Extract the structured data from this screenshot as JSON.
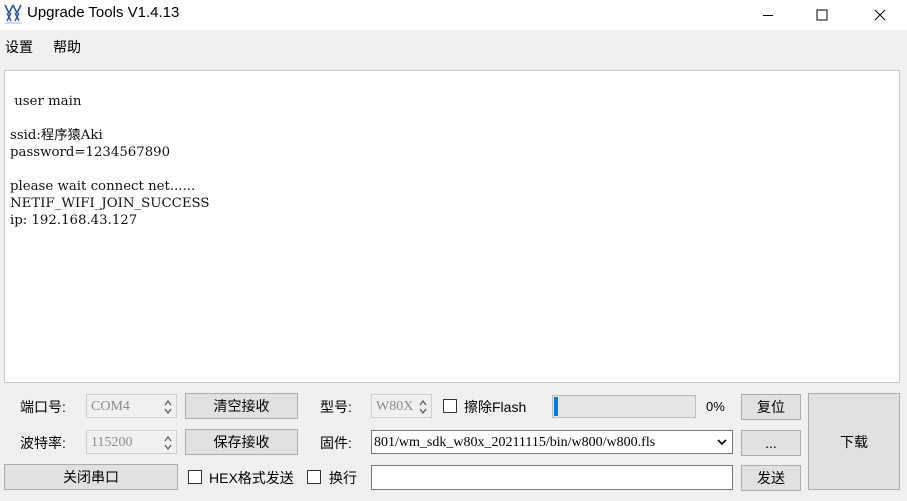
{
  "window": {
    "title": "Upgrade Tools V1.4.13",
    "logo_icon": "wm-logo-icon",
    "controls": [
      "minimize-icon",
      "maximize-icon",
      "close-icon"
    ]
  },
  "menu": {
    "items": [
      "设置",
      "帮助"
    ]
  },
  "console": {
    "lines": [
      " user main",
      "",
      "ssid:程序猿Aki",
      "password=1234567890",
      "",
      "please wait connect net......",
      "NETIF_WIFI_JOIN_SUCCESS",
      "ip: 192.168.43.127"
    ]
  },
  "serial": {
    "port_label": "端口号:",
    "port_value": "COM4",
    "baud_label": "波特率:",
    "baud_value": "115200",
    "clear_label": "清空接收",
    "save_label": "保存接收",
    "close_port_label": "关闭串口",
    "hex_send_label": "HEX格式发送",
    "newline_label": "换行"
  },
  "firmware": {
    "model_label": "型号:",
    "model_value": "W80X",
    "erase_label": "擦除Flash",
    "progress_text": "0%",
    "progress_value": 0.01,
    "file_label": "固件:",
    "file_value": "801/wm_sdk_w80x_20211115/bin/w800/w800.fls",
    "reset_label": "复位",
    "browse_label": "...",
    "download_label": "下载",
    "send_label": "发送",
    "send_input_value": ""
  },
  "colors": {
    "accent": "#0078d7",
    "background": "#f0f0f0",
    "button": "#e1e1e1"
  }
}
